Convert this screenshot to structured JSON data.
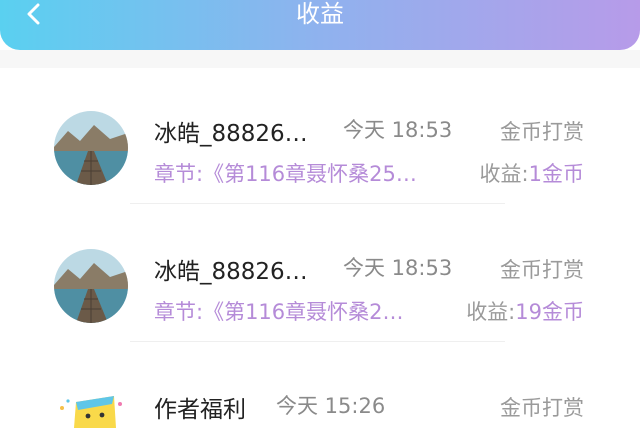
{
  "header": {
    "title": "收益"
  },
  "records": [
    {
      "name": "冰皓_88826…",
      "time": "今天 18:53",
      "type": "金币打赏",
      "chapter": "章节:《第116章聂怀桑25…",
      "earn_label": "收益:",
      "earn_value": "1金币"
    },
    {
      "name": "冰皓_88826…",
      "time": "今天 18:53",
      "type": "金币打赏",
      "chapter": "章节:《第116章聂怀桑2…",
      "earn_label": "收益:",
      "earn_value": "19金币"
    },
    {
      "name": "作者福利",
      "time": "今天 15:26",
      "type": "金币打赏"
    }
  ],
  "icons": {
    "back": "chevron-left-icon",
    "avatar": "landscape-pier-image",
    "welfare": "gift-box-icon"
  },
  "colors": {
    "header_start": "#5ad0f0",
    "header_end": "#b79be9",
    "accent_purple": "#b58bd8"
  }
}
